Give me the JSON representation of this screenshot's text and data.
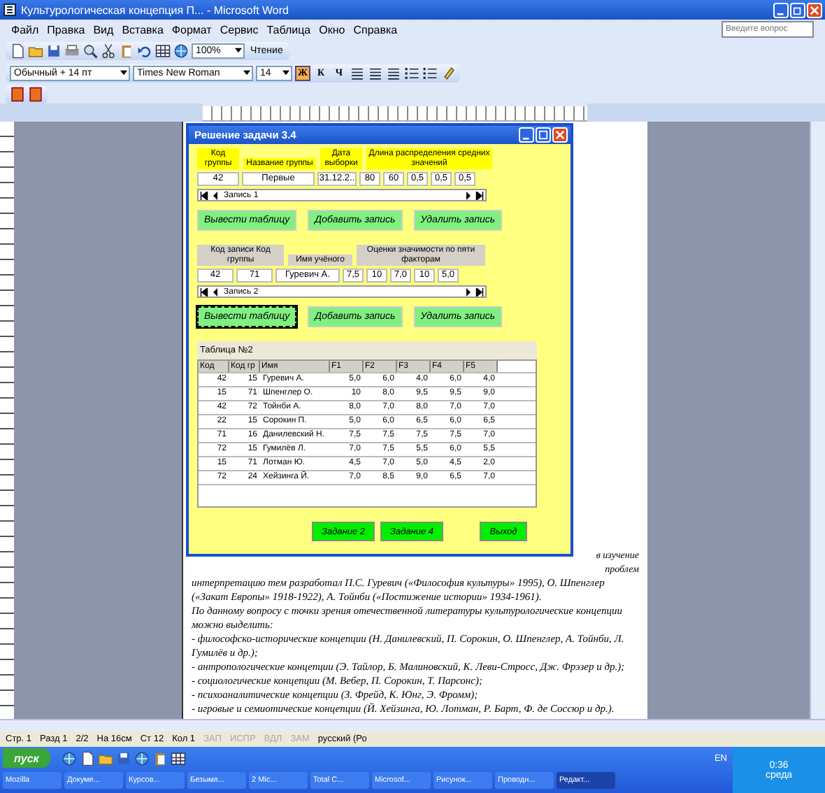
{
  "window": {
    "title": "Культурологическая концепция П... - Microsoft Word"
  },
  "menu": [
    "Файл",
    "Правка",
    "Вид",
    "Вставка",
    "Формат",
    "Сервис",
    "Таблица",
    "Окно",
    "Справка"
  ],
  "help_box": {
    "placeholder": "Введите вопрос"
  },
  "toolbar": {
    "zoom": "100%",
    "reading": "Чтение",
    "style": "Обычный + 14 пт",
    "font": "Times New Roman",
    "size": "14",
    "format_buttons": [
      {
        "label": "Ж",
        "selected": true
      },
      {
        "label": "К",
        "selected": false
      },
      {
        "label": "Ч",
        "selected": false
      }
    ]
  },
  "form": {
    "title": "Решение задачи 3.4",
    "section1": {
      "labels": [
        "Код группы",
        "Название группы",
        "Дата выборки",
        "Длина распределения средних значений"
      ],
      "values": [
        "42",
        "Первые",
        "31.12.2..",
        "80",
        "60",
        "0,5",
        "0,5",
        "0,5"
      ],
      "navigator": "Запись 1",
      "buttons": [
        {
          "label": "Вывести таблицу",
          "focused": false
        },
        {
          "label": "Добавить запись",
          "focused": false
        },
        {
          "label": "Удалить запись",
          "focused": false
        }
      ]
    },
    "section2": {
      "labels": [
        "Код записи    Код группы",
        "Имя учёного",
        "Оценки значимости по пяти факторам"
      ],
      "values": [
        "42",
        "71",
        "Гуревич А.",
        "7,5",
        "10",
        "7,0",
        "10",
        "5,0"
      ],
      "navigator": "Запись 2",
      "buttons": [
        {
          "label": "Вывести таблицу",
          "focused": true
        },
        {
          "label": "Добавить запись",
          "focused": false
        },
        {
          "label": "Удалить запись",
          "focused": false
        }
      ]
    },
    "table": {
      "title": "Таблица №2",
      "columns": [
        "Код",
        "Код гр",
        "Имя",
        "F1",
        "F2",
        "F3",
        "F4",
        "F5"
      ],
      "rows": [
        [
          "42",
          "15",
          "Гуревич А.",
          "5,0",
          "6,0",
          "4,0",
          "6,0",
          "4,0"
        ],
        [
          "15",
          "71",
          "Шпенглер О.",
          "10",
          "8,0",
          "9,5",
          "9,5",
          "9,0"
        ],
        [
          "42",
          "72",
          "Тойнби А.",
          "8,0",
          "7,0",
          "8,0",
          "7,0",
          "7,0"
        ],
        [
          "22",
          "15",
          "Сорокин П.",
          "5,0",
          "6,0",
          "6,5",
          "6,0",
          "6,5"
        ],
        [
          "71",
          "16",
          "Данилевский Н.",
          "7,5",
          "7,5",
          "7,5",
          "7,5",
          "7,0"
        ],
        [
          "72",
          "15",
          "Гумилёв Л.",
          "7,0",
          "7,5",
          "5,5",
          "6,0",
          "5,5"
        ],
        [
          "15",
          "71",
          "Лотман Ю.",
          "4,5",
          "7,0",
          "5,0",
          "4,5",
          "2,0"
        ],
        [
          "72",
          "24",
          "Хейзинга Й.",
          "7,0",
          "8,5",
          "9,0",
          "6,5",
          "7,0"
        ]
      ]
    },
    "footer_buttons": [
      "Задание 2",
      "Задание 4",
      "Выход"
    ]
  },
  "document": {
    "side_lines": [
      "в изучение",
      "проблем"
    ],
    "paragraphs": [
      "интерпретацию тем разработал П.С. Гуревич («Философия культуры» 1995), О. Шпенглер («Закат Европы» 1918-1922), А. Тойнби («Постижение истории» 1934-1961).",
      "По данному вопросу с точки зрения отечественной литературы культурологические концепции можно выделить:",
      "- философско-исторические концепции (Н. Данилевский, П. Сорокин, О. Шпенглер, А. Тойнби, Л. Гумилёв и др.);",
      "- антропологические концепции (Э. Тайлор, Б. Малиновский, К. Леви-Стросс, Дж. Фрэзер и др.);",
      "- социологические концепции (М. Вебер, П. Сорокин, Т. Парсонс);",
      "- психоаналитические концепции (З. Фрейд, К. Юнг, Э. Фромм);",
      "- игровые и семиотические концепции (Й. Хейзинга, Ю. Лотман, Р. Барт, Ф. де Соссюр и др.)."
    ]
  },
  "status_bar": [
    {
      "text": "Стр. 1",
      "disabled": false
    },
    {
      "text": "Разд 1",
      "disabled": false
    },
    {
      "text": "2/2",
      "disabled": false
    },
    {
      "text": "На 16см",
      "disabled": false
    },
    {
      "text": "Ст 12",
      "disabled": false
    },
    {
      "text": "Кол 1",
      "disabled": false
    },
    {
      "text": "ЗАП",
      "disabled": true
    },
    {
      "text": "ИСПР",
      "disabled": true
    },
    {
      "text": "ВДЛ",
      "disabled": true
    },
    {
      "text": "ЗАМ",
      "disabled": true
    },
    {
      "text": "русский (Ро",
      "disabled": false
    }
  ],
  "taskbar": {
    "start": "пуск",
    "language": "EN",
    "clock": "0:36",
    "day": "среда",
    "tasks": [
      {
        "label": "Mozilla",
        "selected": false
      },
      {
        "label": "Докуме...",
        "selected": false
      },
      {
        "label": "Курсов...",
        "selected": false
      },
      {
        "label": "Безымя...",
        "selected": false
      },
      {
        "label": "2 Mic...",
        "selected": false
      },
      {
        "label": "Total C...",
        "selected": false
      },
      {
        "label": "Microsof...",
        "selected": false
      },
      {
        "label": "Рисунок...",
        "selected": false
      },
      {
        "label": "Проводн...",
        "selected": false
      },
      {
        "label": "Редакт...",
        "selected": true
      }
    ]
  }
}
